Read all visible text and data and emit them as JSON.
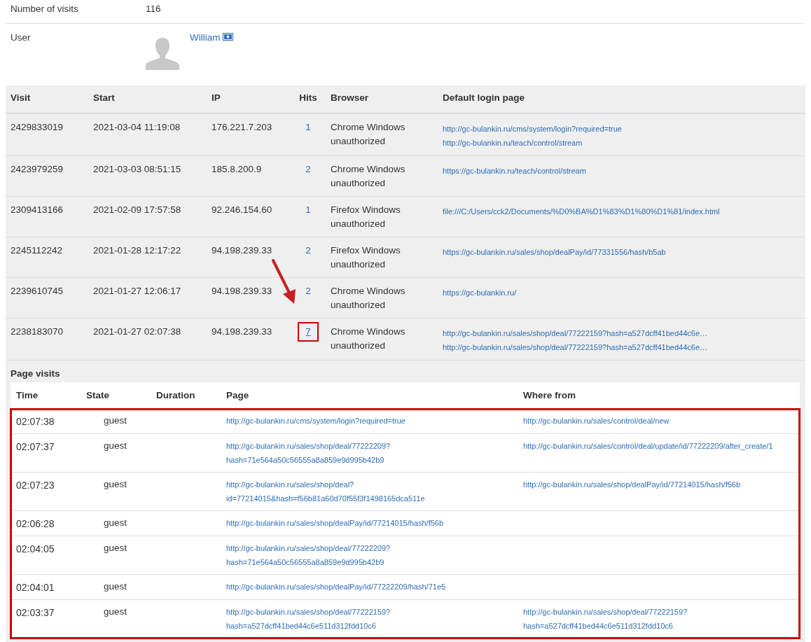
{
  "info": [
    {
      "label": "Number of visits",
      "value": "116"
    }
  ],
  "user": {
    "label": "User",
    "name": "William"
  },
  "visits": {
    "columns": [
      "Visit",
      "Start",
      "IP",
      "Hits",
      "Browser",
      "Default login page"
    ],
    "rows": [
      {
        "visit": "2429833019",
        "start": "2021-03-04 11:19:08",
        "ip": "176.221.7.203",
        "hits": "1",
        "highlighted": false,
        "browser": [
          "Chrome Windows",
          "unauthorized"
        ],
        "pages": [
          "http://gc-bulankin.ru/cms/system/login?required=true",
          "http://gc-bulankin.ru/teach/control/stream"
        ]
      },
      {
        "visit": "2423979259",
        "start": "2021-03-03 08:51:15",
        "ip": "185.8.200.9",
        "hits": "2",
        "highlighted": false,
        "browser": [
          "Chrome Windows",
          "unauthorized"
        ],
        "pages": [
          "https://gc-bulankin.ru/teach/control/stream"
        ]
      },
      {
        "visit": "2309413166",
        "start": "2021-02-09 17:57:58",
        "ip": "92.246.154.60",
        "hits": "1",
        "highlighted": false,
        "browser": [
          "Firefox Windows",
          "unauthorized"
        ],
        "pages": [
          "file:///C:/Users/cck2/Documents/%D0%BA%D1%83%D1%80%D1%81/index.html"
        ]
      },
      {
        "visit": "2245112242",
        "start": "2021-01-28 12:17:22",
        "ip": "94.198.239.33",
        "hits": "2",
        "highlighted": false,
        "browser": [
          "Firefox Windows",
          "unauthorized"
        ],
        "pages": [
          "https://gc-bulankin.ru/sales/shop/dealPay/id/77331556/hash/b5ab"
        ]
      },
      {
        "visit": "2239610745",
        "start": "2021-01-27 12:06:17",
        "ip": "94.198.239.33",
        "hits": "2",
        "highlighted": false,
        "browser": [
          "Chrome Windows",
          "unauthorized"
        ],
        "pages": [
          "https://gc-bulankin.ru/"
        ]
      },
      {
        "visit": "2238183070",
        "start": "2021-01-27 02:07:38",
        "ip": "94.198.239.33",
        "hits": "7",
        "highlighted": true,
        "browser": [
          "Chrome Windows",
          "unauthorized"
        ],
        "pages": [
          "http://gc-bulankin.ru/sales/shop/deal/77222159?hash=a527dcff41bed44c6e…",
          "http://gc-bulankin.ru/sales/shop/deal/77222159?hash=a527dcff41bed44c6e…"
        ]
      }
    ]
  },
  "page_visits": {
    "title": "Page visits",
    "highlighted": true,
    "columns": [
      "Time",
      "State",
      "Duration",
      "Page",
      "Where from"
    ],
    "rows": [
      {
        "time": "02:07:38",
        "state": "guest",
        "page": [
          "http://gc-bulankin.ru/cms/system/login?required=true"
        ],
        "from": [
          "http://gc-bulankin.ru/sales/control/deal/new"
        ]
      },
      {
        "time": "02:07:37",
        "state": "guest",
        "page": [
          "http://gc-bulankin.ru/sales/shop/deal/77222209?",
          "hash=71e564a50c56555a8a859e9d995b42b9"
        ],
        "from": [
          "http://gc-bulankin.ru/sales/control/deal/update/id/77222209/after_create/1"
        ]
      },
      {
        "time": "02:07:23",
        "state": "guest",
        "page": [
          "http://gc-bulankin.ru/sales/shop/deal?",
          "id=77214015&hash=f56b81a60d70f55f3f1498165dca511e"
        ],
        "from": [
          "http://gc-bulankin.ru/sales/shop/dealPay/id/77214015/hash/f56b"
        ]
      },
      {
        "time": "02:06:28",
        "state": "guest",
        "page": [
          "http://gc-bulankin.ru/sales/shop/dealPay/id/77214015/hash/f56b"
        ],
        "from": []
      },
      {
        "time": "02:04:05",
        "state": "guest",
        "page": [
          "http://gc-bulankin.ru/sales/shop/deal/77222209?",
          "hash=71e564a50c56555a8a859e9d995b42b9"
        ],
        "from": []
      },
      {
        "time": "02:04:01",
        "state": "guest",
        "page": [
          "http://gc-bulankin.ru/sales/shop/dealPay/id/77222209/hash/71e5"
        ],
        "from": []
      },
      {
        "time": "02:03:37",
        "state": "guest",
        "page": [
          "http://gc-bulankin.ru/sales/shop/deal/77222159?",
          "hash=a527dcff41bed44c6e511d312fdd10c6"
        ],
        "from": [
          "http://gc-bulankin.ru/sales/shop/deal/77222159?",
          "hash=a527dcff41bed44c6e511d312fdd10c6"
        ]
      }
    ]
  }
}
